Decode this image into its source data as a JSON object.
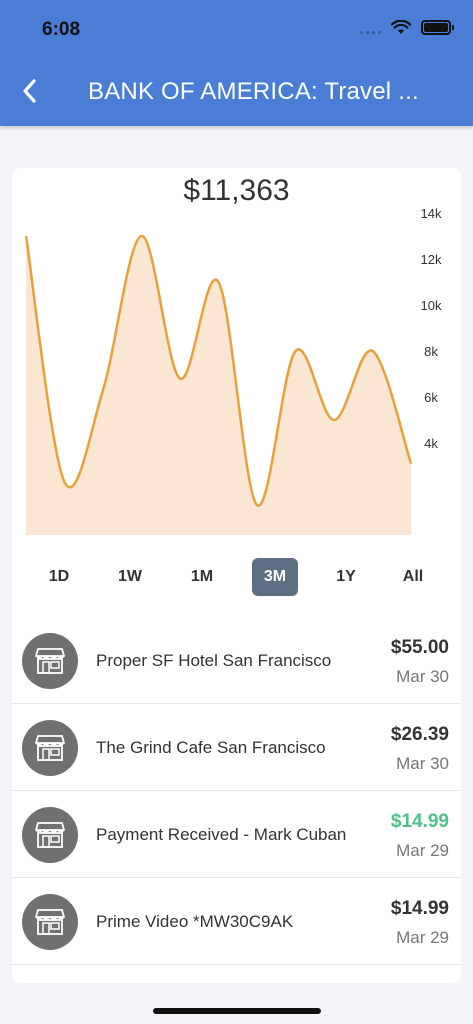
{
  "status": {
    "time": "6:08"
  },
  "header": {
    "title": "BANK OF AMERICA: Travel ..."
  },
  "balance": "$11,363",
  "chart_data": {
    "type": "area",
    "title": "",
    "xlabel": "",
    "ylabel": "",
    "ylim": [
      0,
      14000
    ],
    "y_ticks": [
      "14k",
      "12k",
      "10k",
      "8k",
      "6k",
      "4k"
    ],
    "y_tick_values": [
      14000,
      12000,
      10000,
      8000,
      6000,
      4000
    ],
    "grid": false,
    "line_color": "#e9a03c",
    "fill_color": "#fbe6d3",
    "series": [
      {
        "values": [
          13000,
          2300,
          6300,
          13000,
          6800,
          11000,
          1300,
          8000,
          5000,
          8000,
          3100
        ]
      }
    ]
  },
  "ranges": [
    {
      "label": "1D",
      "active": false
    },
    {
      "label": "1W",
      "active": false
    },
    {
      "label": "1M",
      "active": false
    },
    {
      "label": "3M",
      "active": true
    },
    {
      "label": "1Y",
      "active": false
    },
    {
      "label": "All",
      "active": false
    }
  ],
  "transactions": [
    {
      "name": "Proper SF Hotel San Francisco",
      "amount": "$55.00",
      "date": "Mar 30",
      "credit": false,
      "icon": "storefront-icon"
    },
    {
      "name": "The Grind Cafe San Francisco",
      "amount": "$26.39",
      "date": "Mar 30",
      "credit": false,
      "icon": "storefront-icon"
    },
    {
      "name": "Payment Received - Mark Cuban",
      "amount": "$14.99",
      "date": "Mar 29",
      "credit": true,
      "icon": "storefront-icon"
    },
    {
      "name": "Prime Video *MW30C9AK",
      "amount": "$14.99",
      "date": "Mar 29",
      "credit": false,
      "icon": "storefront-icon"
    }
  ],
  "colors": {
    "header": "#4a7ed6",
    "active_range": "#5c6f84",
    "credit": "#4cc18a",
    "avatar": "#707070"
  }
}
